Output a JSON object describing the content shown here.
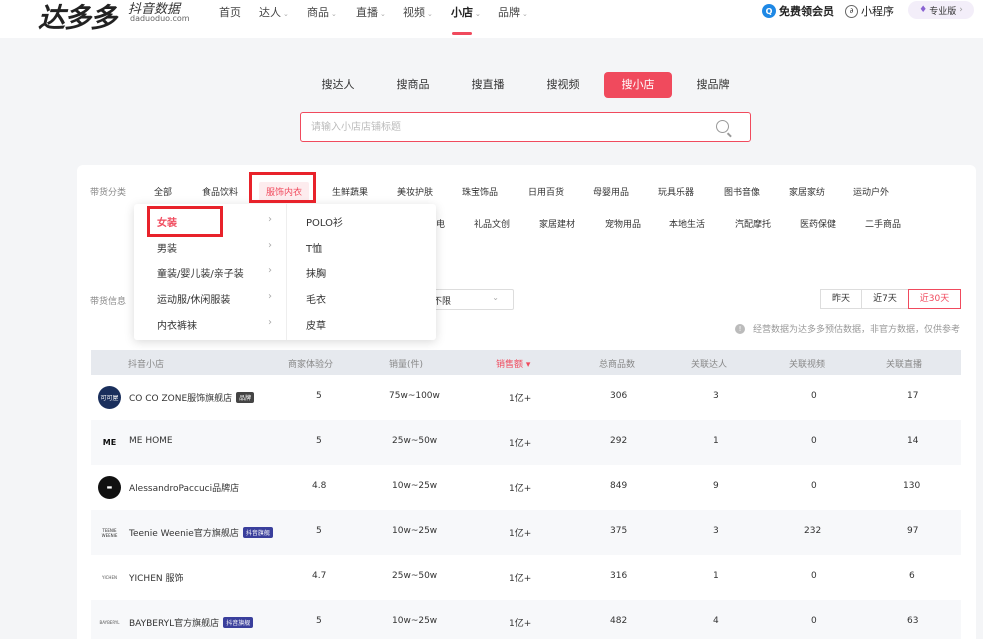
{
  "nav": {
    "logo_text": "达多多",
    "logo_cn": "抖音数据",
    "logo_en": "daduoduo.com",
    "items": [
      {
        "label": "首页",
        "caret": false
      },
      {
        "label": "达人",
        "caret": true
      },
      {
        "label": "商品",
        "caret": true
      },
      {
        "label": "直播",
        "caret": true
      },
      {
        "label": "视频",
        "caret": true
      },
      {
        "label": "小店",
        "caret": true
      },
      {
        "label": "品牌",
        "caret": true
      }
    ],
    "member": "免费领会员",
    "mini_program": "小程序",
    "pro": "专业版",
    "pro_arrow": "›"
  },
  "search_tabs": [
    "搜达人",
    "搜商品",
    "搜直播",
    "搜视频",
    "搜小店",
    "搜品牌"
  ],
  "search": {
    "placeholder": "请输入小店店铺标题"
  },
  "filters": {
    "category_label": "带货分类",
    "row1": [
      "全部",
      "食品饮料",
      "服饰内衣",
      "生鲜蔬果",
      "美妆护肤",
      "珠宝饰品",
      "日用百货",
      "母婴用品",
      "玩具乐器",
      "图书音像",
      "家居家纺",
      "运动户外"
    ],
    "row2": [
      "电",
      "礼品文创",
      "家居建材",
      "宠物用品",
      "本地生活",
      "汽配摩托",
      "医药保健",
      "二手商品"
    ],
    "info_label": "带货信息",
    "select_value": "不限",
    "ranges": [
      "昨天",
      "近7天",
      "近30天"
    ],
    "note": "经营数据为达多多预估数据，非官方数据，仅供参考"
  },
  "dropdown": {
    "left": [
      "女装",
      "男装",
      "童装/婴儿装/亲子装",
      "运动服/休闲服装",
      "内衣裤袜"
    ],
    "arrow": "›",
    "right": [
      "POLO衫",
      "T恤",
      "抹胸",
      "毛衣",
      "皮草"
    ]
  },
  "table": {
    "headers": [
      "抖音小店",
      "商家体验分",
      "销量(件)",
      "销售额",
      "总商品数",
      "关联达人",
      "关联视频",
      "关联直播"
    ],
    "rows": [
      {
        "name": "CO CO ZONE服饰旗舰店",
        "badge": "品牌",
        "avatar": "可可屋",
        "score": "5",
        "sales": "75w~100w",
        "revenue": "1亿+",
        "products": "306",
        "creators": "3",
        "videos": "0",
        "lives": "17"
      },
      {
        "name": "ME HOME",
        "badge": "",
        "avatar": "ME",
        "score": "5",
        "sales": "25w~50w",
        "revenue": "1亿+",
        "products": "292",
        "creators": "1",
        "videos": "0",
        "lives": "14"
      },
      {
        "name": "AlessandroPaccuci品牌店",
        "badge": "",
        "avatar": "",
        "score": "4.8",
        "sales": "10w~25w",
        "revenue": "1亿+",
        "products": "849",
        "creators": "9",
        "videos": "0",
        "lives": "130"
      },
      {
        "name": "Teenie Weenie官方旗舰店",
        "badge": "抖音旗舰",
        "avatar": "TEENIE WEENIE",
        "score": "5",
        "sales": "10w~25w",
        "revenue": "1亿+",
        "products": "375",
        "creators": "3",
        "videos": "232",
        "lives": "97"
      },
      {
        "name": "YICHEN 服饰",
        "badge": "",
        "avatar": "YICHEN",
        "score": "4.7",
        "sales": "25w~50w",
        "revenue": "1亿+",
        "products": "316",
        "creators": "1",
        "videos": "0",
        "lives": "6"
      },
      {
        "name": "BAYBERYL官方旗舰店",
        "badge": "抖音旗舰",
        "avatar": "BAYBERYL",
        "score": "5",
        "sales": "10w~25w",
        "revenue": "1亿+",
        "products": "482",
        "creators": "4",
        "videos": "0",
        "lives": "63"
      }
    ]
  },
  "colors": {
    "accent": "#f04a5d",
    "highlight_box": "#e8222a",
    "brand_badge": "#444444",
    "flagship_badge": "#3a3f9c"
  }
}
